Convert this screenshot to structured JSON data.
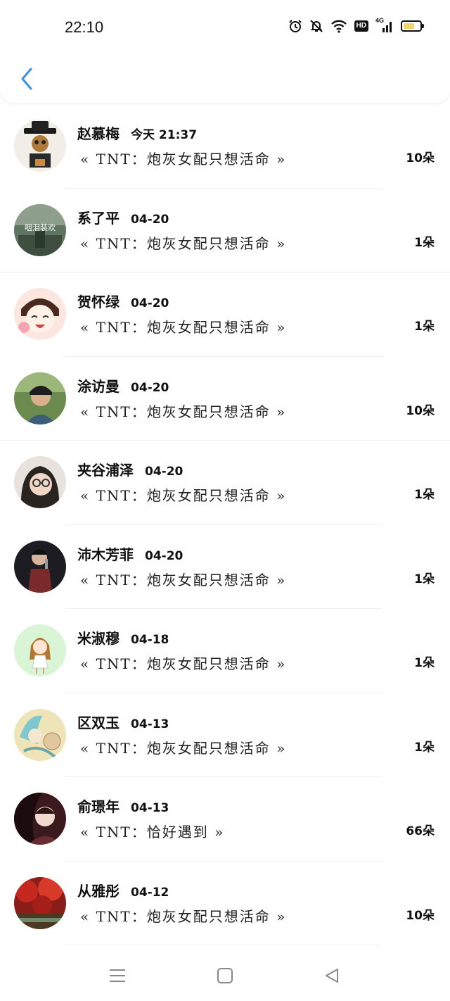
{
  "status_bar": {
    "time": "22:10",
    "hd_badge": "HD",
    "network": "4G",
    "battery_level": 0.7,
    "icons": [
      "alarm-icon",
      "bell-off-icon",
      "wifi-icon",
      "hd-badge",
      "signal-4g-icon",
      "battery-icon"
    ]
  },
  "header": {
    "back_icon": "chevron-left-icon",
    "accent": "#3b8fe0"
  },
  "rows": [
    {
      "name": "赵慕梅",
      "date": "今天 21:37",
      "title": "« TNT：炮灰女配只想活命 »",
      "count": "10朵"
    },
    {
      "name": "系了平",
      "date": "04-20",
      "title": "« TNT：炮灰女配只想活命 »",
      "count": "1朵"
    },
    {
      "name": "贺怀绿",
      "date": "04-20",
      "title": "« TNT：炮灰女配只想活命 »",
      "count": "1朵"
    },
    {
      "name": "涂访曼",
      "date": "04-20",
      "title": "« TNT：炮灰女配只想活命 »",
      "count": "10朵"
    },
    {
      "name": "夹谷浦泽",
      "date": "04-20",
      "title": "« TNT：炮灰女配只想活命 »",
      "count": "1朵"
    },
    {
      "name": "沛木芳菲",
      "date": "04-20",
      "title": "« TNT：炮灰女配只想活命 »",
      "count": "1朵"
    },
    {
      "name": "米淑穆",
      "date": "04-18",
      "title": "« TNT：炮灰女配只想活命 »",
      "count": "1朵"
    },
    {
      "name": "区双玉",
      "date": "04-13",
      "title": "« TNT：炮灰女配只想活命 »",
      "count": "1朵"
    },
    {
      "name": "俞璟年",
      "date": "04-13",
      "title": "« TNT：恰好遇到 »",
      "count": "66朵"
    },
    {
      "name": "从雅彤",
      "date": "04-12",
      "title": "« TNT：炮灰女配只想活命 »",
      "count": "10朵"
    }
  ],
  "avatar_text": "咽泪装欢",
  "nav": {
    "icons": [
      "menu-icon",
      "home-square-icon",
      "back-triangle-icon"
    ]
  }
}
